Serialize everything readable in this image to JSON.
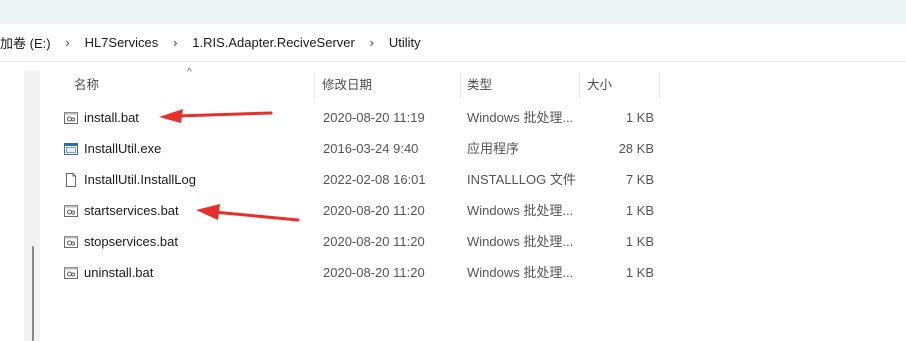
{
  "breadcrumb": [
    "加卷 (E:)",
    "HL7Services",
    "1.RIS.Adapter.ReciveServer",
    "Utility"
  ],
  "columns": {
    "name": "名称",
    "modified": "修改日期",
    "type": "类型",
    "size": "大小"
  },
  "files": [
    {
      "name": "install.bat",
      "modified": "2020-08-20 11:19",
      "type": "Windows 批处理...",
      "size": "1 KB",
      "icon": "batch-file-icon"
    },
    {
      "name": "InstallUtil.exe",
      "modified": "2016-03-24 9:40",
      "type": "应用程序",
      "size": "28 KB",
      "icon": "application-icon"
    },
    {
      "name": "InstallUtil.InstallLog",
      "modified": "2022-02-08 16:01",
      "type": "INSTALLLOG 文件",
      "size": "7 KB",
      "icon": "document-icon"
    },
    {
      "name": "startservices.bat",
      "modified": "2020-08-20 11:20",
      "type": "Windows 批处理...",
      "size": "1 KB",
      "icon": "batch-file-icon"
    },
    {
      "name": "stopservices.bat",
      "modified": "2020-08-20 11:20",
      "type": "Windows 批处理...",
      "size": "1 KB",
      "icon": "batch-file-icon"
    },
    {
      "name": "uninstall.bat",
      "modified": "2020-08-20 11:20",
      "type": "Windows 批处理...",
      "size": "1 KB",
      "icon": "batch-file-icon"
    }
  ],
  "annotations": {
    "arrow_color": "#e8302a"
  }
}
